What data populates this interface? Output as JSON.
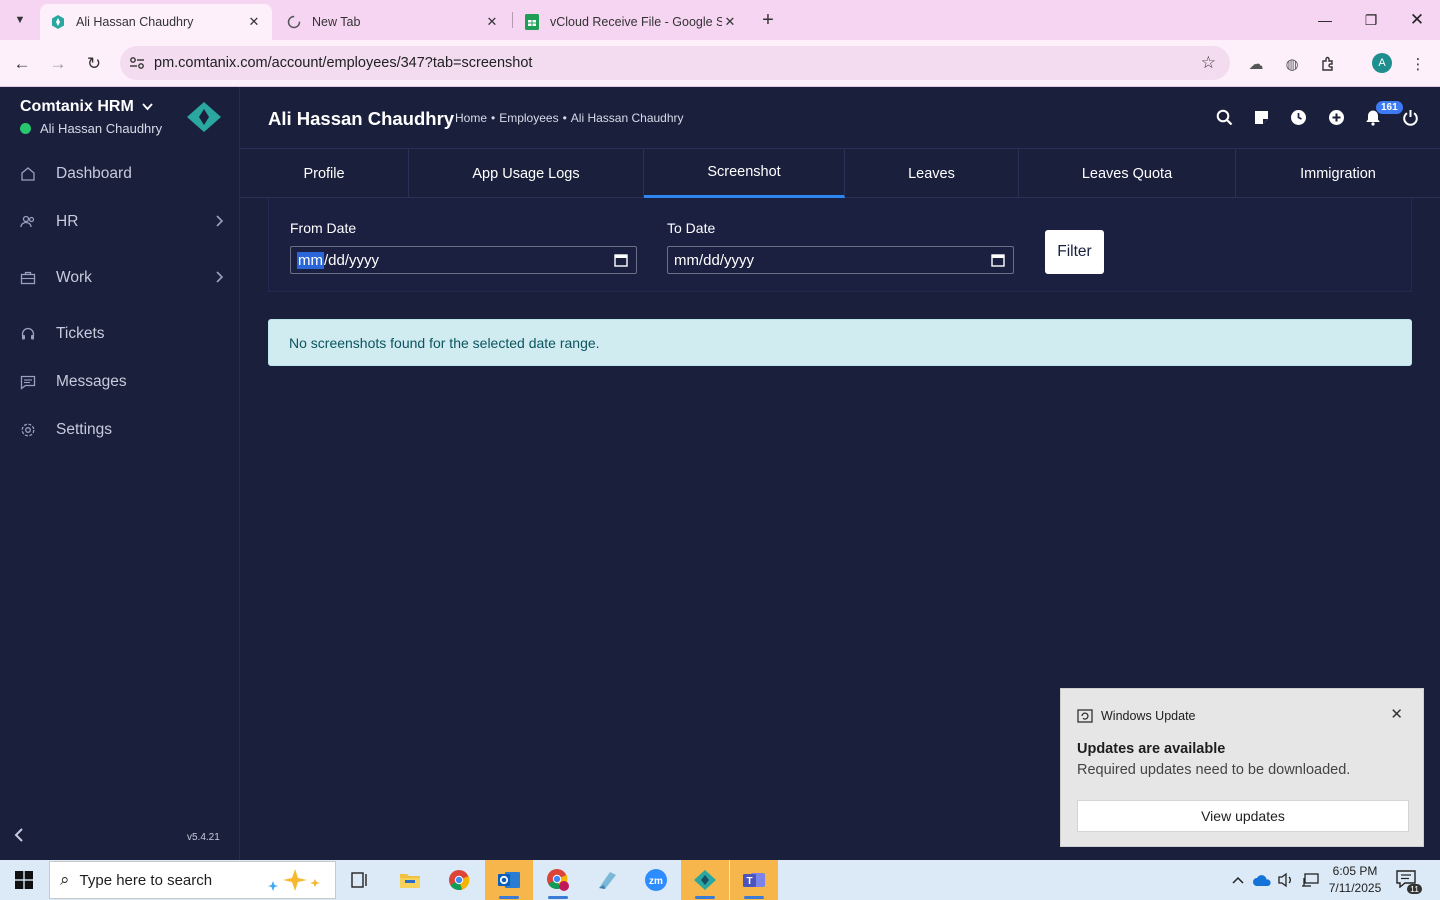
{
  "browser": {
    "tabs": [
      {
        "title": "Ali Hassan Chaudhry",
        "active": true
      },
      {
        "title": "New Tab",
        "active": false
      },
      {
        "title": "vCloud Receive File - Google Sh",
        "active": false
      }
    ],
    "url": "pm.comtanix.com/account/employees/347?tab=screenshot",
    "profile_initial": "A"
  },
  "sidebar": {
    "brand": "Comtanix HRM",
    "user": "Ali Hassan Chaudhry",
    "items": [
      {
        "label": "Dashboard",
        "icon": "home-icon"
      },
      {
        "label": "HR",
        "icon": "users-icon",
        "has_submenu": true
      },
      {
        "label": "Work",
        "icon": "briefcase-icon",
        "has_submenu": true
      },
      {
        "label": "Tickets",
        "icon": "headset-icon"
      },
      {
        "label": "Messages",
        "icon": "message-icon"
      },
      {
        "label": "Settings",
        "icon": "gear-icon"
      }
    ],
    "version": "v5.4.21"
  },
  "header": {
    "title": "Ali Hassan Chaudhry",
    "breadcrumb": [
      "Home",
      "•",
      "Employees",
      "•",
      "Ali Hassan Chaudhry"
    ],
    "notification_count": "161"
  },
  "tabs": [
    {
      "label": "Profile",
      "active": false
    },
    {
      "label": "App Usage Logs",
      "active": false
    },
    {
      "label": "Screenshot",
      "active": true
    },
    {
      "label": "Leaves",
      "active": false
    },
    {
      "label": "Leaves Quota",
      "active": false
    },
    {
      "label": "Immigration",
      "active": false
    }
  ],
  "filter": {
    "from_label": "From Date",
    "from_value_part1": "mm",
    "from_value_part2": "/dd/yyyy",
    "to_label": "To Date",
    "to_value": "mm/dd/yyyy",
    "button": "Filter"
  },
  "alert": "No screenshots found for the selected date range.",
  "toast": {
    "app": "Windows Update",
    "title": "Updates are available",
    "body": "Required updates need to be downloaded.",
    "button": "View updates"
  },
  "taskbar": {
    "search_placeholder": "Type here to search",
    "time": "6:05 PM",
    "date": "7/11/2025",
    "notif_count": "11"
  },
  "colors": {
    "bg": "#1a1f3c",
    "accent": "#2d86f0",
    "alert_bg": "#d1ecf1",
    "online": "#28c76f",
    "badge": "#3d7bf6"
  }
}
